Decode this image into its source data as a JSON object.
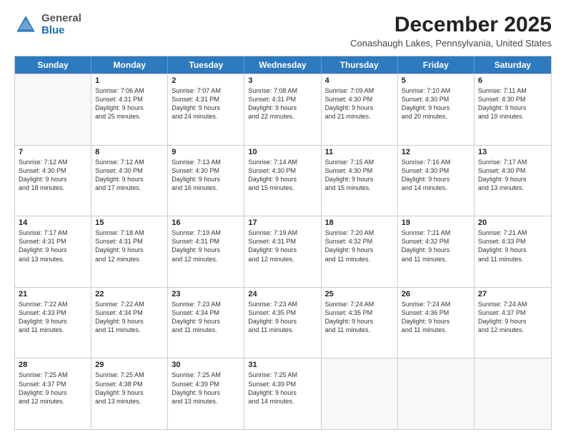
{
  "header": {
    "logo": {
      "general": "General",
      "blue": "Blue"
    },
    "month_year": "December 2025",
    "location": "Conashaugh Lakes, Pennsylvania, United States"
  },
  "days_of_week": [
    "Sunday",
    "Monday",
    "Tuesday",
    "Wednesday",
    "Thursday",
    "Friday",
    "Saturday"
  ],
  "weeks": [
    [
      {
        "day": "",
        "lines": []
      },
      {
        "day": "1",
        "lines": [
          "Sunrise: 7:06 AM",
          "Sunset: 4:31 PM",
          "Daylight: 9 hours",
          "and 25 minutes."
        ]
      },
      {
        "day": "2",
        "lines": [
          "Sunrise: 7:07 AM",
          "Sunset: 4:31 PM",
          "Daylight: 9 hours",
          "and 24 minutes."
        ]
      },
      {
        "day": "3",
        "lines": [
          "Sunrise: 7:08 AM",
          "Sunset: 4:31 PM",
          "Daylight: 9 hours",
          "and 22 minutes."
        ]
      },
      {
        "day": "4",
        "lines": [
          "Sunrise: 7:09 AM",
          "Sunset: 4:30 PM",
          "Daylight: 9 hours",
          "and 21 minutes."
        ]
      },
      {
        "day": "5",
        "lines": [
          "Sunrise: 7:10 AM",
          "Sunset: 4:30 PM",
          "Daylight: 9 hours",
          "and 20 minutes."
        ]
      },
      {
        "day": "6",
        "lines": [
          "Sunrise: 7:11 AM",
          "Sunset: 4:30 PM",
          "Daylight: 9 hours",
          "and 19 minutes."
        ]
      }
    ],
    [
      {
        "day": "7",
        "lines": [
          "Sunrise: 7:12 AM",
          "Sunset: 4:30 PM",
          "Daylight: 9 hours",
          "and 18 minutes."
        ]
      },
      {
        "day": "8",
        "lines": [
          "Sunrise: 7:12 AM",
          "Sunset: 4:30 PM",
          "Daylight: 9 hours",
          "and 17 minutes."
        ]
      },
      {
        "day": "9",
        "lines": [
          "Sunrise: 7:13 AM",
          "Sunset: 4:30 PM",
          "Daylight: 9 hours",
          "and 16 minutes."
        ]
      },
      {
        "day": "10",
        "lines": [
          "Sunrise: 7:14 AM",
          "Sunset: 4:30 PM",
          "Daylight: 9 hours",
          "and 15 minutes."
        ]
      },
      {
        "day": "11",
        "lines": [
          "Sunrise: 7:15 AM",
          "Sunset: 4:30 PM",
          "Daylight: 9 hours",
          "and 15 minutes."
        ]
      },
      {
        "day": "12",
        "lines": [
          "Sunrise: 7:16 AM",
          "Sunset: 4:30 PM",
          "Daylight: 9 hours",
          "and 14 minutes."
        ]
      },
      {
        "day": "13",
        "lines": [
          "Sunrise: 7:17 AM",
          "Sunset: 4:30 PM",
          "Daylight: 9 hours",
          "and 13 minutes."
        ]
      }
    ],
    [
      {
        "day": "14",
        "lines": [
          "Sunrise: 7:17 AM",
          "Sunset: 4:31 PM",
          "Daylight: 9 hours",
          "and 13 minutes."
        ]
      },
      {
        "day": "15",
        "lines": [
          "Sunrise: 7:18 AM",
          "Sunset: 4:31 PM",
          "Daylight: 9 hours",
          "and 12 minutes."
        ]
      },
      {
        "day": "16",
        "lines": [
          "Sunrise: 7:19 AM",
          "Sunset: 4:31 PM",
          "Daylight: 9 hours",
          "and 12 minutes."
        ]
      },
      {
        "day": "17",
        "lines": [
          "Sunrise: 7:19 AM",
          "Sunset: 4:31 PM",
          "Daylight: 9 hours",
          "and 12 minutes."
        ]
      },
      {
        "day": "18",
        "lines": [
          "Sunrise: 7:20 AM",
          "Sunset: 4:32 PM",
          "Daylight: 9 hours",
          "and 11 minutes."
        ]
      },
      {
        "day": "19",
        "lines": [
          "Sunrise: 7:21 AM",
          "Sunset: 4:32 PM",
          "Daylight: 9 hours",
          "and 11 minutes."
        ]
      },
      {
        "day": "20",
        "lines": [
          "Sunrise: 7:21 AM",
          "Sunset: 4:33 PM",
          "Daylight: 9 hours",
          "and 11 minutes."
        ]
      }
    ],
    [
      {
        "day": "21",
        "lines": [
          "Sunrise: 7:22 AM",
          "Sunset: 4:33 PM",
          "Daylight: 9 hours",
          "and 11 minutes."
        ]
      },
      {
        "day": "22",
        "lines": [
          "Sunrise: 7:22 AM",
          "Sunset: 4:34 PM",
          "Daylight: 9 hours",
          "and 11 minutes."
        ]
      },
      {
        "day": "23",
        "lines": [
          "Sunrise: 7:23 AM",
          "Sunset: 4:34 PM",
          "Daylight: 9 hours",
          "and 11 minutes."
        ]
      },
      {
        "day": "24",
        "lines": [
          "Sunrise: 7:23 AM",
          "Sunset: 4:35 PM",
          "Daylight: 9 hours",
          "and 11 minutes."
        ]
      },
      {
        "day": "25",
        "lines": [
          "Sunrise: 7:24 AM",
          "Sunset: 4:35 PM",
          "Daylight: 9 hours",
          "and 11 minutes."
        ]
      },
      {
        "day": "26",
        "lines": [
          "Sunrise: 7:24 AM",
          "Sunset: 4:36 PM",
          "Daylight: 9 hours",
          "and 11 minutes."
        ]
      },
      {
        "day": "27",
        "lines": [
          "Sunrise: 7:24 AM",
          "Sunset: 4:37 PM",
          "Daylight: 9 hours",
          "and 12 minutes."
        ]
      }
    ],
    [
      {
        "day": "28",
        "lines": [
          "Sunrise: 7:25 AM",
          "Sunset: 4:37 PM",
          "Daylight: 9 hours",
          "and 12 minutes."
        ]
      },
      {
        "day": "29",
        "lines": [
          "Sunrise: 7:25 AM",
          "Sunset: 4:38 PM",
          "Daylight: 9 hours",
          "and 13 minutes."
        ]
      },
      {
        "day": "30",
        "lines": [
          "Sunrise: 7:25 AM",
          "Sunset: 4:39 PM",
          "Daylight: 9 hours",
          "and 13 minutes."
        ]
      },
      {
        "day": "31",
        "lines": [
          "Sunrise: 7:25 AM",
          "Sunset: 4:39 PM",
          "Daylight: 9 hours",
          "and 14 minutes."
        ]
      },
      {
        "day": "",
        "lines": []
      },
      {
        "day": "",
        "lines": []
      },
      {
        "day": "",
        "lines": []
      }
    ]
  ]
}
